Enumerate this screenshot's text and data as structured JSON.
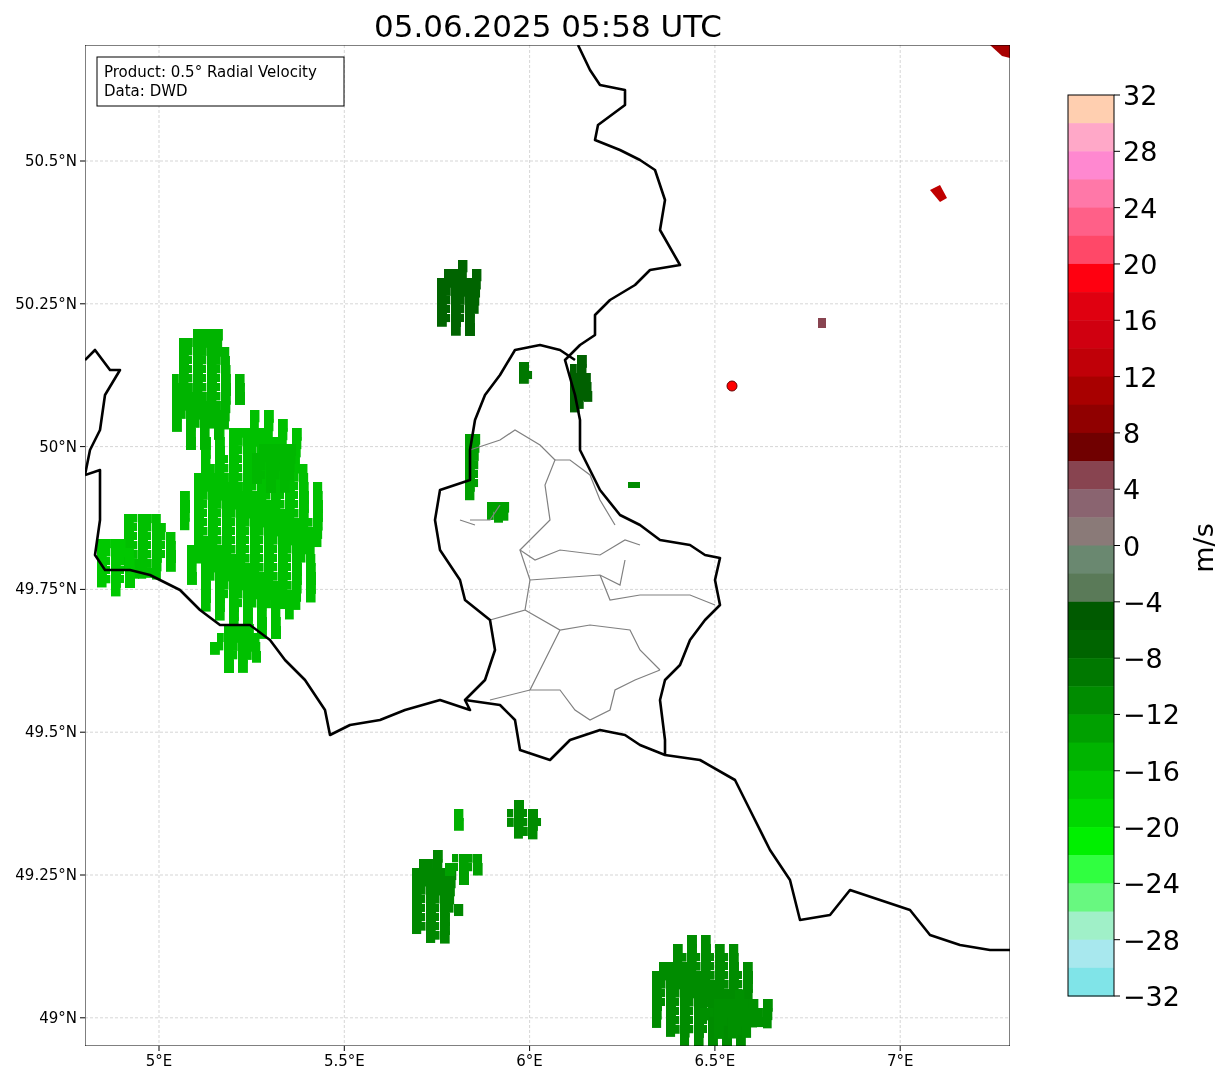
{
  "title": "05.06.2025 05:58 UTC",
  "info_box": {
    "lines": [
      "Product: 0.5° Radial Velocity",
      "Data: DWD"
    ]
  },
  "map": {
    "lat_labels": [
      "50.5°N",
      "50.25°N",
      "50°N",
      "49.75°N",
      "49.5°N",
      "49.25°N",
      "49°N"
    ],
    "lon_labels": [
      "5°E",
      "5.5°E",
      "6°E",
      "6.5°E",
      "7°E"
    ]
  },
  "colorbar": {
    "label": "m/s",
    "ticks": [
      "32",
      "28",
      "24",
      "20",
      "16",
      "12",
      "8",
      "4",
      "0",
      "−4",
      "−8",
      "−12",
      "−16",
      "−20",
      "−24",
      "−28",
      "−32"
    ],
    "bins": [
      {
        "color": "#ffcfb0"
      },
      {
        "color": "#ffa8c8"
      },
      {
        "color": "#ff88d0"
      },
      {
        "color": "#ff78a8"
      },
      {
        "color": "#ff6088"
      },
      {
        "color": "#ff4868"
      },
      {
        "color": "#ff0010"
      },
      {
        "color": "#e00010"
      },
      {
        "color": "#d00010"
      },
      {
        "color": "#c00008"
      },
      {
        "color": "#a80000"
      },
      {
        "color": "#900000"
      },
      {
        "color": "#700000"
      },
      {
        "color": "#884450"
      },
      {
        "color": "#8a6470"
      },
      {
        "color": "#8a7a78"
      },
      {
        "color": "#6a8870"
      },
      {
        "color": "#5a7a58"
      },
      {
        "color": "#005a00"
      },
      {
        "color": "#006400"
      },
      {
        "color": "#007800"
      },
      {
        "color": "#008c00"
      },
      {
        "color": "#00a000"
      },
      {
        "color": "#00b400"
      },
      {
        "color": "#00c800"
      },
      {
        "color": "#00d800"
      },
      {
        "color": "#00f000"
      },
      {
        "color": "#30ff40"
      },
      {
        "color": "#68f880"
      },
      {
        "color": "#a0f0c8"
      },
      {
        "color": "#a8e8ee"
      },
      {
        "color": "#80e4e8"
      }
    ]
  }
}
